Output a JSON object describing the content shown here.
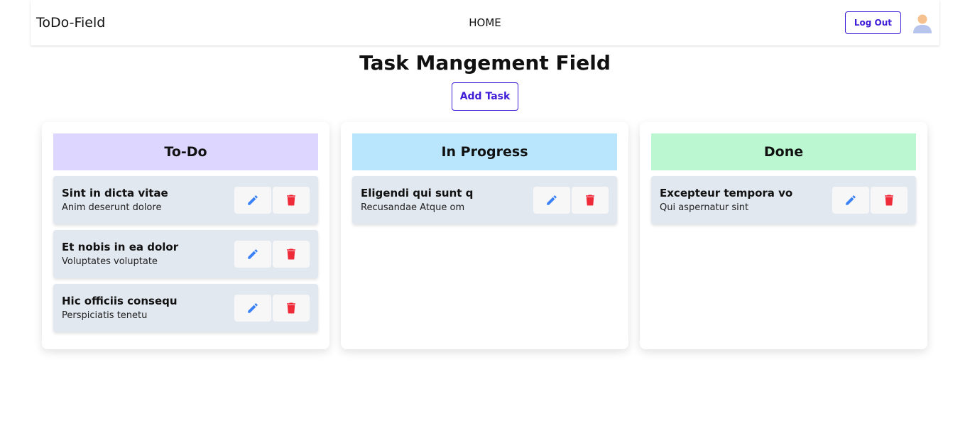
{
  "navbar": {
    "brand": "ToDo-Field",
    "home_link": "HOME",
    "logout_label": "Log Out"
  },
  "page": {
    "title": "Task Mangement Field",
    "add_task_label": "Add Task"
  },
  "colors": {
    "accent": "#3f1dd8",
    "todo_header": "#ddd6fe",
    "inprogress_header": "#bae6fd",
    "done_header": "#bbf7d0",
    "card_bg": "#e2e8f0",
    "edit_icon": "#3b82f6",
    "delete_icon": "#ef2b3a"
  },
  "icons": {
    "edit": "pencil-icon",
    "delete": "trash-icon",
    "avatar": "user-avatar-icon"
  },
  "columns": [
    {
      "title": "To-Do",
      "color": "#ddd6fe",
      "tasks": [
        {
          "title": "Sint in dicta vitae",
          "description": "Anim deserunt dolore"
        },
        {
          "title": "Et nobis in ea dolor",
          "description": "Voluptates voluptate"
        },
        {
          "title": "Hic officiis consequ",
          "description": "Perspiciatis tenetu"
        }
      ]
    },
    {
      "title": "In Progress",
      "color": "#bae6fd",
      "tasks": [
        {
          "title": "Eligendi qui sunt q",
          "description": "Recusandae Atque om"
        }
      ]
    },
    {
      "title": "Done",
      "color": "#bbf7d0",
      "tasks": [
        {
          "title": "Excepteur tempora vo",
          "description": "Qui aspernatur sint"
        }
      ]
    }
  ]
}
